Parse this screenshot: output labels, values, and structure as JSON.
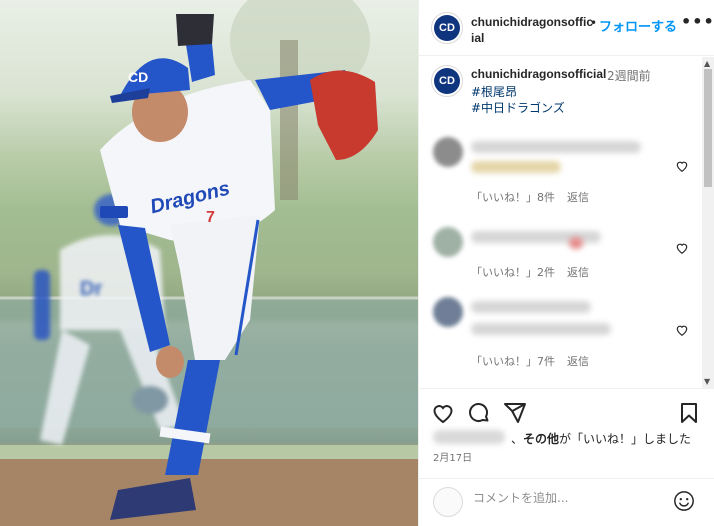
{
  "post": {
    "username": "chunichidragonsofficial",
    "follow_label": "フォローする",
    "more_label": "•••",
    "avatar_logo": "CD",
    "caption": {
      "username": "chunichidragonsofficial",
      "time_ago": "2週間前",
      "hashtags": [
        "#根尾昂",
        "#中日ドラゴンズ"
      ]
    },
    "comments": [
      {
        "likes_label": "「いいね！」8件",
        "reply_label": "返信"
      },
      {
        "likes_label": "「いいね！」2件",
        "reply_label": "返信"
      },
      {
        "likes_label": "「いいね！」7件",
        "reply_label": "返信"
      }
    ],
    "liked_by_suffix_pre": "、",
    "liked_by_others": "その他",
    "liked_by_suffix": "が「いいね！」しました",
    "date": "2月17日",
    "add_comment_placeholder": "コメントを追加...",
    "jersey_number": "7",
    "jersey_text": "Dragons"
  },
  "icons": [
    "heart-icon",
    "comment-icon",
    "share-icon",
    "bookmark-icon",
    "emoji-icon",
    "more-icon"
  ],
  "colors": {
    "link": "#0095f6",
    "hashtag": "#00376b",
    "team_blue": "#10357f"
  }
}
